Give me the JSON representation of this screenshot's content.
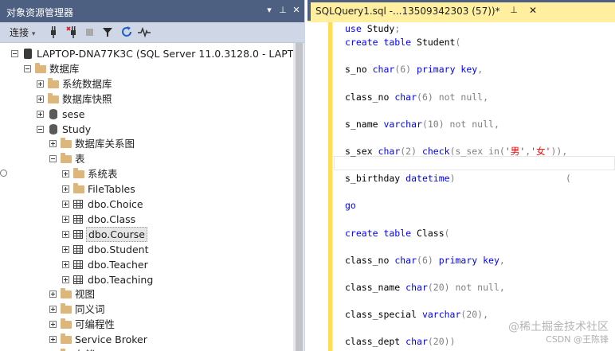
{
  "object_explorer": {
    "title": "对象资源管理器",
    "title_buttons": {
      "dropdown": "▾",
      "pin": "⊥",
      "close": "✕"
    },
    "toolbar": {
      "connect_label": "连接",
      "dropdown": "▾"
    },
    "tree": [
      {
        "label": "LAPTOP-DNA77K3C (SQL Server 11.0.3128.0 - LAPTOP",
        "icon": "server-icon",
        "expander": "minus",
        "level": 0
      },
      {
        "label": "数据库",
        "icon": "folder-icon",
        "expander": "minus",
        "level": 1
      },
      {
        "label": "系统数据库",
        "icon": "folder-icon",
        "expander": "plus",
        "level": 2
      },
      {
        "label": "数据库快照",
        "icon": "folder-icon",
        "expander": "plus",
        "level": 2
      },
      {
        "label": "sese",
        "icon": "database-icon",
        "expander": "plus",
        "level": 2
      },
      {
        "label": "Study",
        "icon": "database-icon",
        "expander": "minus",
        "level": 2
      },
      {
        "label": "数据库关系图",
        "icon": "folder-icon",
        "expander": "plus",
        "level": 3
      },
      {
        "label": "表",
        "icon": "folder-icon",
        "expander": "minus",
        "level": 3
      },
      {
        "label": "系统表",
        "icon": "folder-icon",
        "expander": "plus",
        "level": 4
      },
      {
        "label": "FileTables",
        "icon": "folder-icon",
        "expander": "plus",
        "level": 4
      },
      {
        "label": "dbo.Choice",
        "icon": "table-icon",
        "expander": "plus",
        "level": 4
      },
      {
        "label": "dbo.Class",
        "icon": "table-icon",
        "expander": "plus",
        "level": 4
      },
      {
        "label": "dbo.Course",
        "icon": "table-icon",
        "expander": "plus",
        "level": 4,
        "selected": true
      },
      {
        "label": "dbo.Student",
        "icon": "table-icon",
        "expander": "plus",
        "level": 4
      },
      {
        "label": "dbo.Teacher",
        "icon": "table-icon",
        "expander": "plus",
        "level": 4
      },
      {
        "label": "dbo.Teaching",
        "icon": "table-icon",
        "expander": "plus",
        "level": 4
      },
      {
        "label": "视图",
        "icon": "folder-icon",
        "expander": "plus",
        "level": 3
      },
      {
        "label": "同义词",
        "icon": "folder-icon",
        "expander": "plus",
        "level": 3
      },
      {
        "label": "可编程性",
        "icon": "folder-icon",
        "expander": "plus",
        "level": 3
      },
      {
        "label": "Service Broker",
        "icon": "folder-icon",
        "expander": "plus",
        "level": 3
      },
      {
        "label": "存储",
        "icon": "folder-icon",
        "expander": "plus",
        "level": 3
      }
    ]
  },
  "editor": {
    "tab_title": "SQLQuery1.sql -...13509342303 (57))*",
    "tab_pin": "⊥",
    "tab_close": "✕",
    "code_lines": [
      [
        {
          "t": "use ",
          "c": "kw"
        },
        {
          "t": "Study",
          "c": "id"
        },
        {
          "t": ";",
          "c": "gr"
        }
      ],
      [
        {
          "t": "create table ",
          "c": "kw"
        },
        {
          "t": "Student",
          "c": "id"
        },
        {
          "t": "(",
          "c": "gr"
        }
      ],
      [],
      [
        {
          "t": "s_no ",
          "c": "id"
        },
        {
          "t": "char",
          "c": "dt"
        },
        {
          "t": "(6) ",
          "c": "gr"
        },
        {
          "t": "primary key",
          "c": "kw"
        },
        {
          "t": ",",
          "c": "gr"
        }
      ],
      [],
      [
        {
          "t": "class_no ",
          "c": "id"
        },
        {
          "t": "char",
          "c": "dt"
        },
        {
          "t": "(6) not null,",
          "c": "gr"
        }
      ],
      [],
      [
        {
          "t": "s_name ",
          "c": "id"
        },
        {
          "t": "varchar",
          "c": "dt"
        },
        {
          "t": "(10) not null,",
          "c": "gr"
        }
      ],
      [],
      [
        {
          "t": "s_sex ",
          "c": "id"
        },
        {
          "t": "char",
          "c": "dt"
        },
        {
          "t": "(2) ",
          "c": "gr"
        },
        {
          "t": "check",
          "c": "kw"
        },
        {
          "t": "(s_sex in(",
          "c": "gr"
        },
        {
          "t": "'男'",
          "c": "st"
        },
        {
          "t": ",",
          "c": "gr"
        },
        {
          "t": "'女'",
          "c": "st"
        },
        {
          "t": ")),",
          "c": "gr"
        }
      ],
      [],
      [
        {
          "t": "s_birthday ",
          "c": "id"
        },
        {
          "t": "datetime",
          "c": "dt"
        },
        {
          "t": ")                    (",
          "c": "gr"
        }
      ],
      [],
      [
        {
          "t": "go",
          "c": "kw"
        }
      ],
      [],
      [
        {
          "t": "create table ",
          "c": "kw"
        },
        {
          "t": "Class",
          "c": "id"
        },
        {
          "t": "(",
          "c": "gr"
        }
      ],
      [],
      [
        {
          "t": "class_no ",
          "c": "id"
        },
        {
          "t": "char",
          "c": "dt"
        },
        {
          "t": "(6) ",
          "c": "gr"
        },
        {
          "t": "primary key",
          "c": "kw"
        },
        {
          "t": ",",
          "c": "gr"
        }
      ],
      [],
      [
        {
          "t": "class_name ",
          "c": "id"
        },
        {
          "t": "char",
          "c": "dt"
        },
        {
          "t": "(20) not null,",
          "c": "gr"
        }
      ],
      [],
      [
        {
          "t": "class_special ",
          "c": "id"
        },
        {
          "t": "varchar",
          "c": "dt"
        },
        {
          "t": "(20),",
          "c": "gr"
        }
      ],
      [],
      [
        {
          "t": "class_dept ",
          "c": "id"
        },
        {
          "t": "char",
          "c": "dt"
        },
        {
          "t": "(20))",
          "c": "gr"
        }
      ]
    ]
  },
  "watermark": {
    "line1": "@稀土掘金技术社区",
    "line2": "CSDN @王陈锋"
  }
}
